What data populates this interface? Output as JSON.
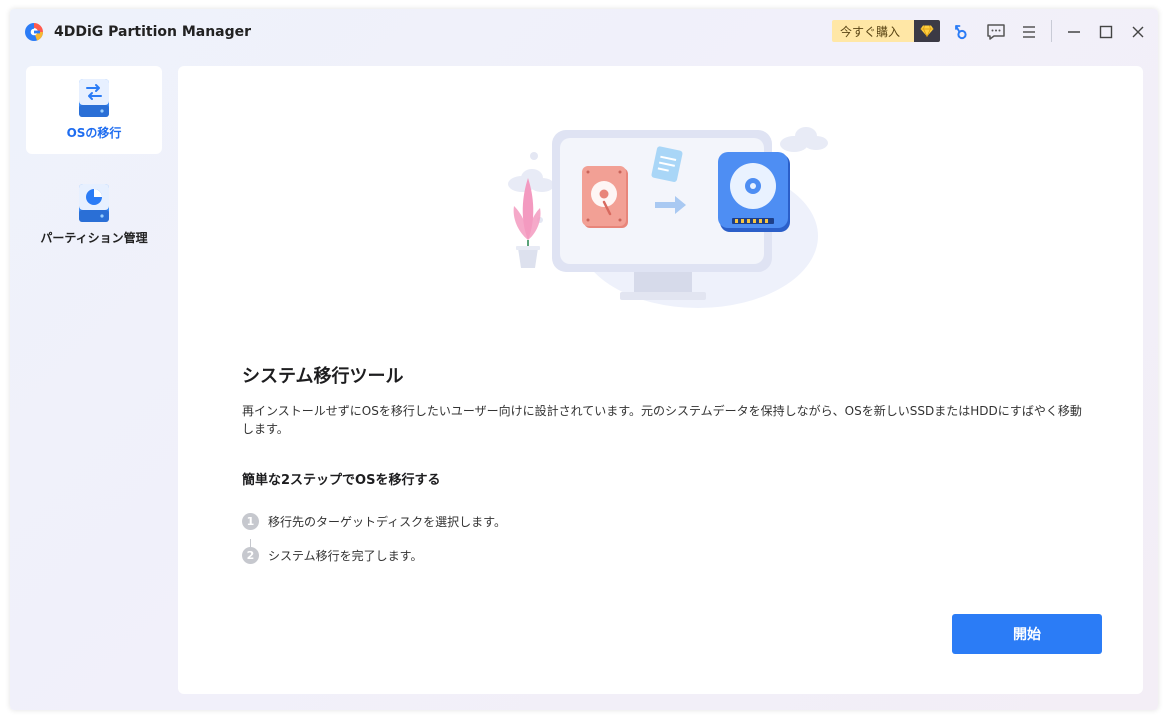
{
  "app": {
    "title": "4DDiG Partition Manager"
  },
  "titlebar": {
    "buy_label": "今すぐ購入",
    "icons": [
      "gem-icon",
      "key-icon",
      "feedback-icon",
      "menu-icon",
      "minimize-icon",
      "maximize-icon",
      "close-icon"
    ]
  },
  "sidebar": {
    "items": [
      {
        "label": "OSの移行",
        "icon": "os-migration-icon",
        "active": true
      },
      {
        "label": "パーティション管理",
        "icon": "partition-icon",
        "active": false
      }
    ]
  },
  "main": {
    "title": "システム移行ツール",
    "description": "再インストールせずにOSを移行したいユーザー向けに設計されています。元のシステムデータを保持しながら、OSを新しいSSDまたはHDDにすばやく移動します。",
    "steps_title": "簡単な2ステップでOSを移行する",
    "steps": [
      {
        "number": "1",
        "text": "移行先のターゲットディスクを選択します。"
      },
      {
        "number": "2",
        "text": "システム移行を完了します。"
      }
    ],
    "start_label": "開始"
  },
  "colors": {
    "accent": "#2b7cf6",
    "active_nav_text": "#1f6df0",
    "buy_bg": "#ffe7a6"
  }
}
